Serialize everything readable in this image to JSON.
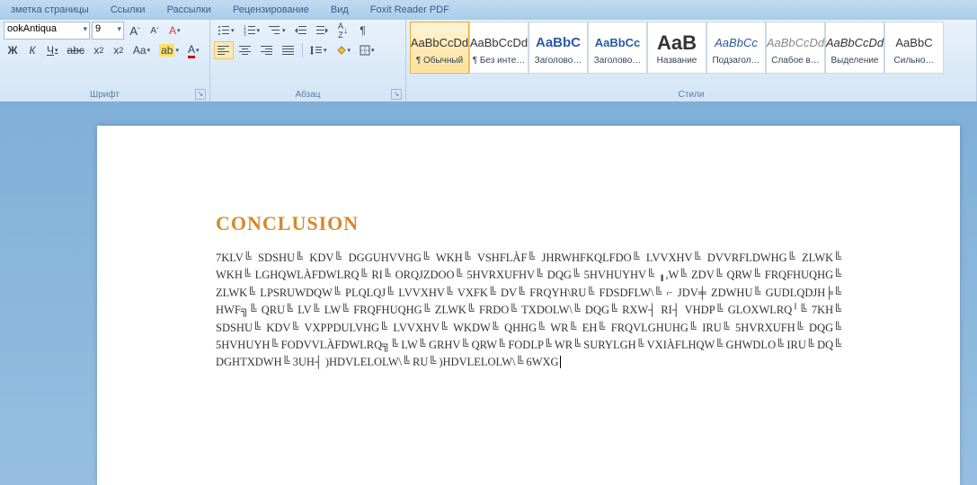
{
  "tabs": {
    "page_layout": "зметка страницы",
    "references": "Ссылки",
    "mailings": "Рассылки",
    "review": "Рецензирование",
    "view": "Вид",
    "foxit": "Foxit Reader PDF"
  },
  "font": {
    "name": "ookAntiqua",
    "size": "9",
    "grow": "A↑",
    "shrink": "A↓",
    "clear": "⌫",
    "bold": "Ж",
    "italic": "К",
    "underline": "Ч",
    "strike": "abc",
    "subscript": "x₂",
    "superscript": "x²",
    "case": "Aa",
    "highlight": "ab",
    "color": "A",
    "group_label": "Шрифт"
  },
  "paragraph": {
    "bullets": "≡",
    "numbering": "≡",
    "multilevel": "≡",
    "dec_indent": "⇤",
    "inc_indent": "⇥",
    "sort": "A↓Z",
    "show_marks": "¶",
    "align_left": "≡",
    "align_center": "≡",
    "align_right": "≡",
    "justify": "≡",
    "spacing": "↕≡",
    "shading": "◧",
    "borders": "▦",
    "group_label": "Абзац"
  },
  "styles": {
    "group_label": "Стили",
    "items": [
      {
        "preview": "AaBbCcDd",
        "name": "¶ Обычный",
        "selected": true
      },
      {
        "preview": "AaBbCcDd",
        "name": "¶ Без инте…"
      },
      {
        "preview": "AaBbC",
        "name": "Заголово…",
        "color": "#2a5aa0",
        "bold": true,
        "size": "15px"
      },
      {
        "preview": "AaBbCc",
        "name": "Заголово…",
        "color": "#2a5aa0",
        "bold": true,
        "size": "13px"
      },
      {
        "preview": "AaB",
        "name": "Название",
        "bold": true,
        "size": "22px"
      },
      {
        "preview": "AaBbCc",
        "name": "Подзагол…",
        "color": "#2a5aa0",
        "italic": true,
        "size": "13px"
      },
      {
        "preview": "AaBbCcDd",
        "name": "Слабое в…",
        "color": "#888",
        "italic": true
      },
      {
        "preview": "AaBbCcDd",
        "name": "Выделение",
        "italic": true
      },
      {
        "preview": "AaBbC",
        "name": "Сильно…"
      }
    ]
  },
  "document": {
    "heading": "CONCLUSION",
    "body": "7KLV╚ SDSHU╚ KDV╚ DGGUHVVHG╚ WKH╚ VSHFLÀF╚ JHRWHFKQLFDO╚ LVVXHV╚ DVVRFLDWHG╚ ZLWK╚ WKH╚ LGHQWLÀFDWLRQ╚ RI╚ ORQJZDOO╚ 5HVRXUFHV╚ DQG╚ 5HVHUYHV╚ ╻,W╚ ZDV╚ QRW╚ FRQFHUQHG╚ ZLWK╚ LPSRUWDQW╚ PLQLQJ╚ LVVXHV╚ VХFK╚ DV╚ FRQYH\\RU╚ FDSDFLW\\╚ ⌐ JDV╪ ZDWHU╚ GUDLQDJH╞╚ HWF╗╚ QRU╚ LV╚ LW╚ FRQFHUQHG╚ ZLWK╚ FRDO╚ TXDOLW\\╚ DQG╚ RХW┤ RI┤ VHDP╚ GLOХWLRQ╵╚ 7KH╚ SDSHU╚ KDV╚ VХPPDULVHG╚ LVVХHV╚ WKDW╚ QHHG╚ WR╚ EH╚ FRQVLGHUHG╚ IRU╚ 5HVRХUFH╚ DQG╚ 5HVHUYH╚ FODVVLÀFDWLRQ╗╚ LW╚ GRHV╚ QRW╚ FODLP╚ WR╚ SURYLGH╚ VХIÀFLHQW╚ GHWDLO╚ IRU╚ DQ╚ DGHTХDWH╚ 3UH┤ )HDVLELOLW\\╚ RU╚ )HDVLELOLW\\╚ 6WХG"
  }
}
